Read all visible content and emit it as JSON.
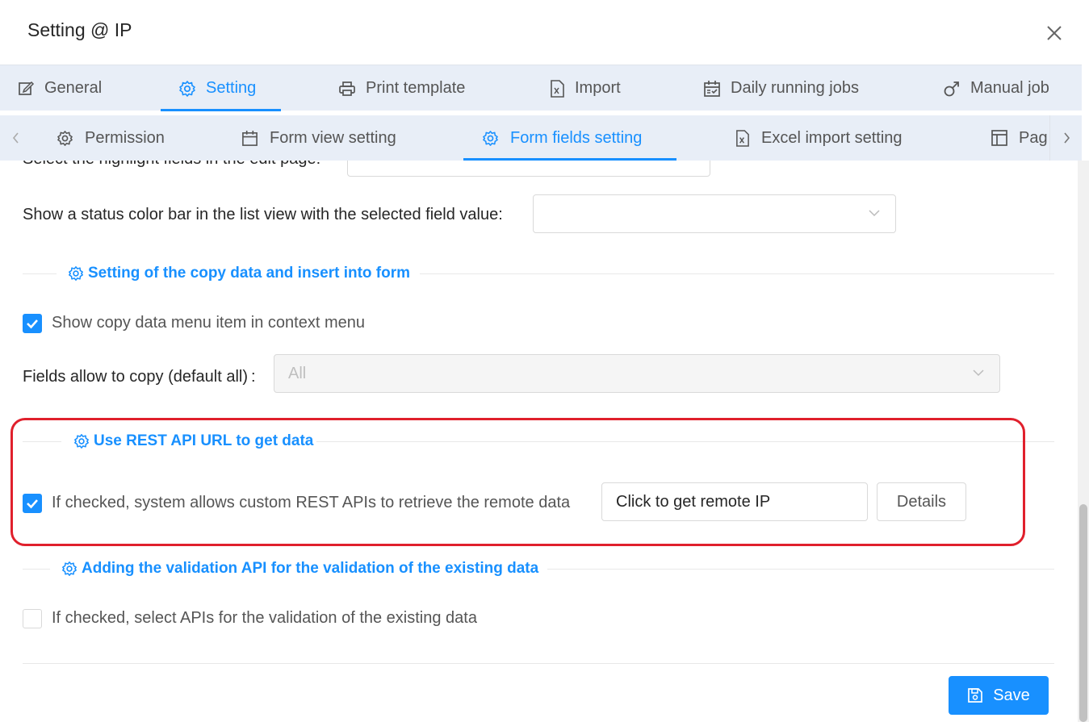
{
  "dialog": {
    "title": "Setting @ IP"
  },
  "main_tabs": [
    {
      "label": "General",
      "icon": "edit-icon",
      "active": false
    },
    {
      "label": "Setting",
      "icon": "gear-icon",
      "active": true
    },
    {
      "label": "Print template",
      "icon": "printer-icon",
      "active": false
    },
    {
      "label": "Import",
      "icon": "excel-file-icon",
      "active": false
    },
    {
      "label": "Daily running jobs",
      "icon": "calendar-check-icon",
      "active": false
    },
    {
      "label": "Manual job",
      "icon": "male-icon",
      "active": false
    }
  ],
  "sub_tabs": [
    {
      "label": "Permission",
      "icon": "gear-icon",
      "active": false
    },
    {
      "label": "Form view setting",
      "icon": "calendar-icon",
      "active": false
    },
    {
      "label": "Form fields setting",
      "icon": "gear-icon",
      "active": true
    },
    {
      "label": "Excel import setting",
      "icon": "excel-file-icon",
      "active": false
    },
    {
      "label": "Pag",
      "icon": "layout-icon",
      "active": false
    }
  ],
  "form": {
    "highlight_field_label": "Select the highlight fields in the edit page:",
    "status_color_label": "Show a status color bar in the list view with the selected field value:",
    "status_color_value": "",
    "copy_section_title": "Setting of the copy data and insert into form",
    "copy_menu_label": "Show copy data menu item in context menu",
    "copy_menu_checked": true,
    "fields_allow_copy_label": "Fields allow to copy (default all)",
    "fields_allow_copy_colon": ":",
    "fields_allow_copy_placeholder": "All",
    "rest_section_title": "Use REST API URL to get data",
    "rest_label": "If checked, system allows custom REST APIs to retrieve the remote data",
    "rest_checked": true,
    "rest_input_value": "Click to get remote IP",
    "details_button": "Details",
    "validation_section_title": "Adding the validation API for the validation of the existing data",
    "validation_label": "If checked, select APIs for the validation of the existing data",
    "validation_checked": false
  },
  "footer": {
    "save_button": "Save"
  },
  "colors": {
    "accent": "#1890ff",
    "highlight": "#e0202c",
    "tab_bar": "#e8eef7"
  }
}
